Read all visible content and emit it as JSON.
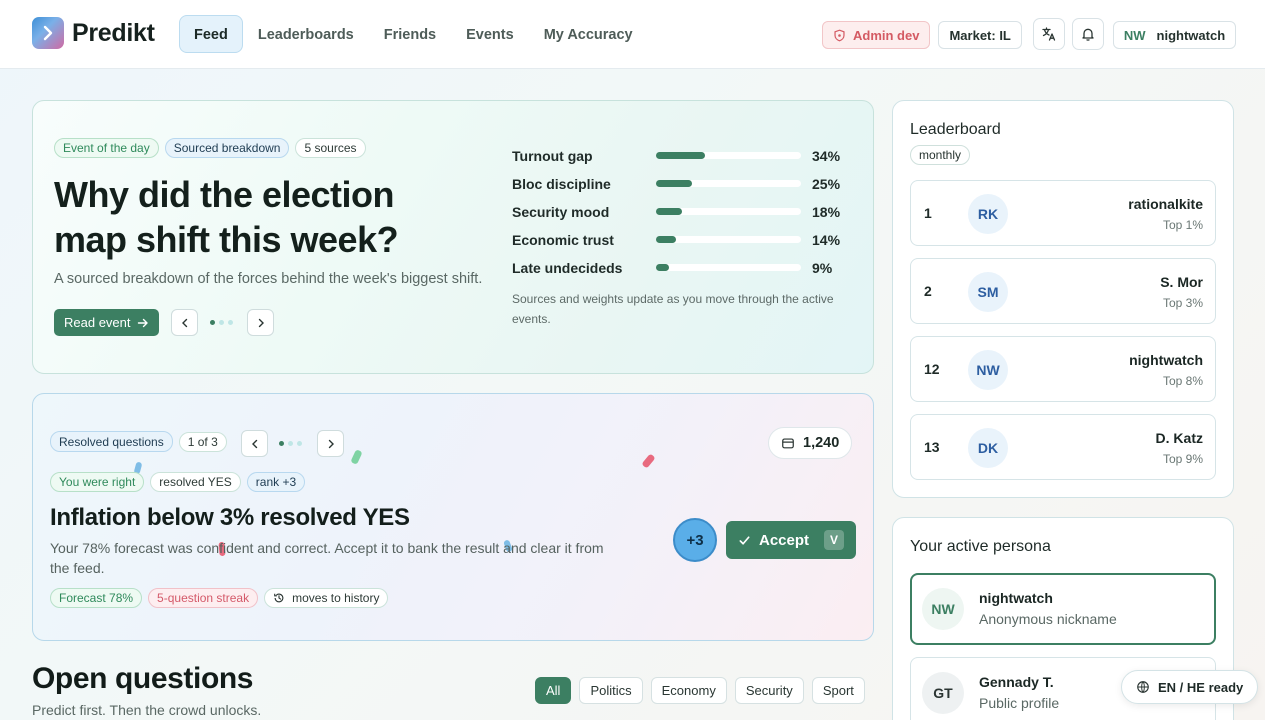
{
  "header": {
    "brand": "Predikt",
    "nav": [
      "Feed",
      "Leaderboards",
      "Friends",
      "Events",
      "My Accuracy"
    ],
    "admin_label": "Admin dev",
    "market_label": "Market: IL",
    "user_initials": "NW",
    "user_name": "nightwatch"
  },
  "hero": {
    "tags": [
      "Event of the day",
      "Sourced breakdown",
      "5 sources"
    ],
    "title": "Why did the election map shift this week?",
    "subtitle": "A sourced breakdown of the forces behind the week's biggest shift.",
    "read_label": "Read event",
    "factors": [
      {
        "label": "Turnout gap",
        "value": 34,
        "display": "34%"
      },
      {
        "label": "Bloc discipline",
        "value": 25,
        "display": "25%"
      },
      {
        "label": "Security mood",
        "value": 18,
        "display": "18%"
      },
      {
        "label": "Economic trust",
        "value": 14,
        "display": "14%"
      },
      {
        "label": "Late undecideds",
        "value": 9,
        "display": "9%"
      }
    ],
    "note": "Sources and weights update as you move through the active events."
  },
  "resolved": {
    "label": "Resolved questions",
    "pager": "1 of 3",
    "coins": "1,240",
    "tags": [
      "You were right",
      "resolved YES",
      "rank +3"
    ],
    "title": "Inflation below 3% resolved YES",
    "desc": "Your 78% forecast was confident and correct. Accept it to bank the result and clear it from the feed.",
    "tags2": [
      "Forecast 78%",
      "5-question streak",
      "moves to history"
    ],
    "bonus": "+3",
    "accept_label": "Accept",
    "accept_key": "V"
  },
  "open": {
    "title": "Open questions",
    "subtitle": "Predict first. Then the crowd unlocks.",
    "filters": [
      "All",
      "Politics",
      "Economy",
      "Security",
      "Sport"
    ]
  },
  "leaderboard": {
    "title": "Leaderboard",
    "period": "monthly",
    "rows": [
      {
        "rank": "1",
        "initials": "RK",
        "name": "rationalkite",
        "sub": "Top 1%"
      },
      {
        "rank": "2",
        "initials": "SM",
        "name": "S. Mor",
        "sub": "Top 3%"
      },
      {
        "rank": "12",
        "initials": "NW",
        "name": "nightwatch",
        "sub": "Top 8%"
      },
      {
        "rank": "13",
        "initials": "DK",
        "name": "D. Katz",
        "sub": "Top 9%"
      }
    ]
  },
  "persona": {
    "title": "Your active persona",
    "items": [
      {
        "initials": "NW",
        "name": "nightwatch",
        "sub": "Anonymous nickname"
      },
      {
        "initials": "GT",
        "name": "Gennady T.",
        "sub": "Public profile"
      }
    ]
  },
  "lang_badge": "EN / HE ready",
  "colors": {
    "accent": "#3c7f62",
    "accent_blue": "#5aaee8",
    "admin_red": "#d45a63"
  }
}
